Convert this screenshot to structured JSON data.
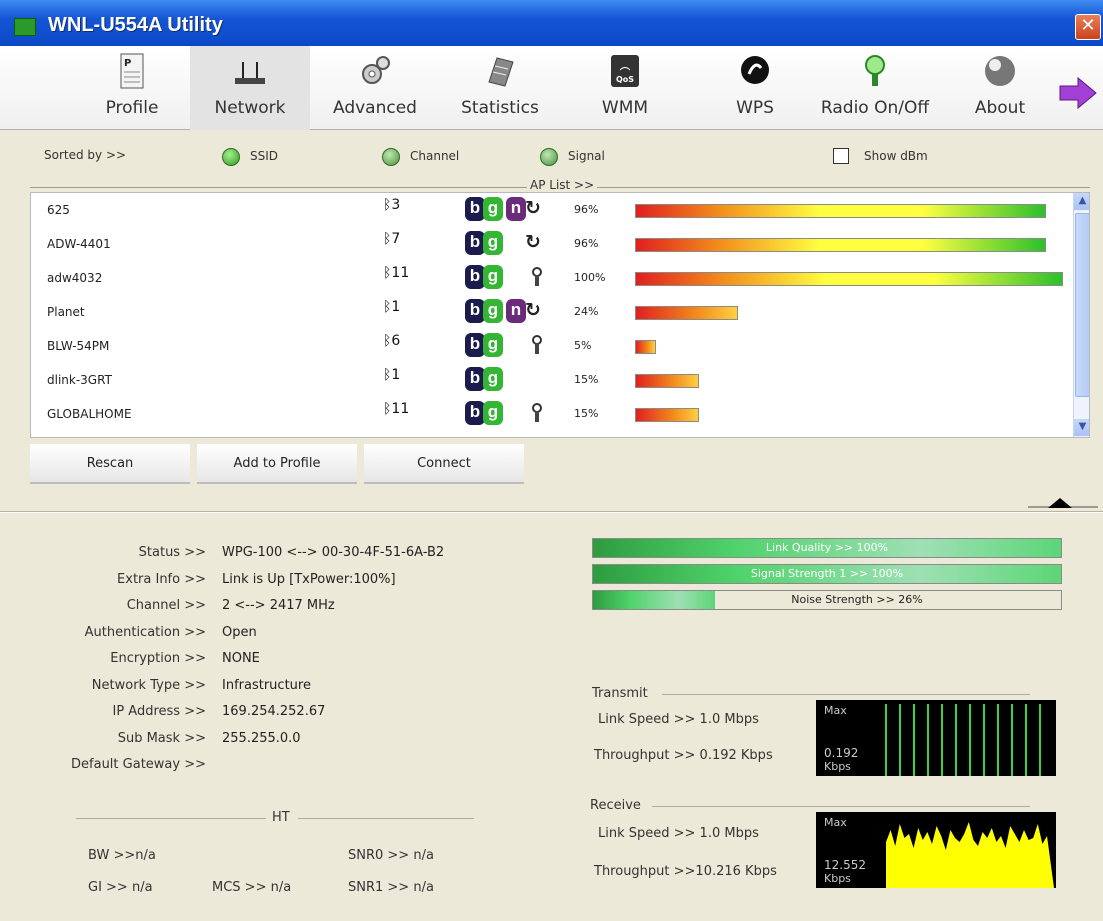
{
  "window": {
    "title": "WNL-U554A Utility"
  },
  "toolbar": [
    {
      "label": "Profile"
    },
    {
      "label": "Network"
    },
    {
      "label": "Advanced"
    },
    {
      "label": "Statistics"
    },
    {
      "label": "WMM"
    },
    {
      "label": "WPS"
    },
    {
      "label": "Radio On/Off"
    },
    {
      "label": "About"
    }
  ],
  "sort": {
    "label": "Sorted by >>",
    "ssid": "SSID",
    "channel": "Channel",
    "signal": "Signal",
    "show_dbm": "Show dBm",
    "ap_list": "AP List >>"
  },
  "ap_list": [
    {
      "ssid": "625",
      "channel": "3",
      "n": true,
      "security": "wps",
      "signal": "96%",
      "level": 0.96
    },
    {
      "ssid": "ADW-4401",
      "channel": "7",
      "n": false,
      "security": "wps",
      "signal": "96%",
      "level": 0.96
    },
    {
      "ssid": "adw4032",
      "channel": "11",
      "n": false,
      "security": "lock",
      "signal": "100%",
      "level": 1.0
    },
    {
      "ssid": "Planet",
      "channel": "1",
      "n": true,
      "security": "wps",
      "signal": "24%",
      "level": 0.24
    },
    {
      "ssid": "BLW-54PM",
      "channel": "6",
      "n": false,
      "security": "lock",
      "signal": "5%",
      "level": 0.05
    },
    {
      "ssid": "dlink-3GRT",
      "channel": "1",
      "n": false,
      "security": "none",
      "signal": "15%",
      "level": 0.15
    },
    {
      "ssid": "GLOBALHOME",
      "channel": "11",
      "n": false,
      "security": "lock",
      "signal": "15%",
      "level": 0.15
    }
  ],
  "buttons": {
    "rescan": "Rescan",
    "add_profile": "Add to Profile",
    "connect": "Connect"
  },
  "info": [
    {
      "key": "Status >>",
      "value": "WPG-100 <--> 00-30-4F-51-6A-B2"
    },
    {
      "key": "Extra Info >>",
      "value": "Link is Up [TxPower:100%]"
    },
    {
      "key": "Channel >>",
      "value": "2 <--> 2417 MHz"
    },
    {
      "key": "Authentication >>",
      "value": "Open"
    },
    {
      "key": "Encryption >>",
      "value": "NONE"
    },
    {
      "key": "Network Type >>",
      "value": "Infrastructure"
    },
    {
      "key": "IP Address >>",
      "value": "169.254.252.67"
    },
    {
      "key": "Sub Mask >>",
      "value": "255.255.0.0"
    },
    {
      "key": "Default Gateway >>",
      "value": ""
    }
  ],
  "ht": {
    "title": "HT",
    "bw": "BW >>n/a",
    "gi": "GI >> n/a",
    "mcs": "MCS >>  n/a",
    "snr0": "SNR0 >>  n/a",
    "snr1": "SNR1 >> n/a"
  },
  "meters": [
    {
      "label": "Link Quality >> 100%",
      "level": 1.0
    },
    {
      "label": "Signal Strength 1 >> 100%",
      "level": 1.0
    },
    {
      "label": "Noise Strength >> 26%",
      "level": 0.26
    }
  ],
  "transmit": {
    "title": "Transmit",
    "link_speed": "Link Speed >> 1.0 Mbps",
    "throughput": "Throughput >> 0.192 Kbps",
    "max": "Max",
    "value": "0.192",
    "unit": "Kbps"
  },
  "receive": {
    "title": "Receive",
    "link_speed": "Link Speed >> 1.0 Mbps",
    "throughput": "Throughput >>10.216 Kbps",
    "max": "Max",
    "value": "12.552",
    "unit": "Kbps"
  },
  "colors": {
    "titlebar": "#1556d6",
    "panel": "#ece9d8",
    "meter_green": "#3dcf5f",
    "receive_fill": "#ffff00",
    "transmit_line": "#3cd23c"
  }
}
